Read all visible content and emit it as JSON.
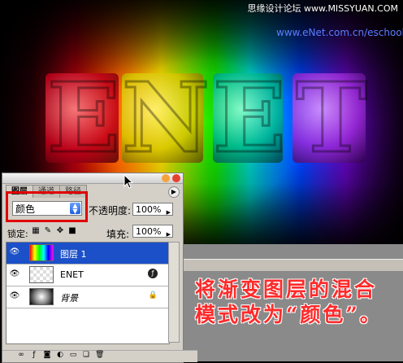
{
  "watermarks": {
    "top_right": "思缘设计论坛 www.MISSYUAN.COM",
    "url": "www.eNet.com.cn/eschool"
  },
  "artwork": {
    "letters": [
      "E",
      "N",
      "E",
      "T"
    ]
  },
  "layers_panel": {
    "tabs": [
      "图层",
      "通道",
      "路径"
    ],
    "blend_mode": "颜色",
    "opacity_label": "不透明度:",
    "opacity_value": "100%",
    "lock_label": "锁定:",
    "fill_label": "填充:",
    "fill_value": "100%",
    "layers": [
      {
        "name": "图层 1",
        "selected": true
      },
      {
        "name": "ENET",
        "selected": false
      },
      {
        "name": "背景",
        "selected": false
      }
    ]
  },
  "caption": "将渐变图层的混合模式改为“颜色”。",
  "colors": {
    "highlight_box": "#e00000",
    "selected_layer": "#1c50c8",
    "caption_text": "#ff2a2a"
  }
}
